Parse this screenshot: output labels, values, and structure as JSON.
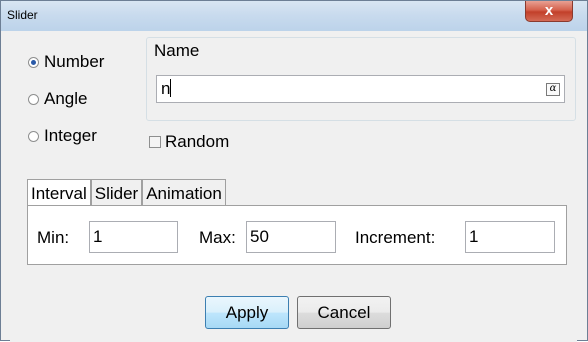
{
  "window": {
    "title": "Slider",
    "close_glyph": "x"
  },
  "type_options": [
    {
      "label": "Number",
      "checked": true
    },
    {
      "label": "Angle",
      "checked": false
    },
    {
      "label": "Integer",
      "checked": false
    }
  ],
  "name_section": {
    "label": "Name",
    "value": "n",
    "alpha_symbol": "α"
  },
  "random": {
    "label": "Random",
    "checked": false
  },
  "tabs": [
    {
      "label": "Interval",
      "active": true
    },
    {
      "label": "Slider",
      "active": false
    },
    {
      "label": "Animation",
      "active": false
    }
  ],
  "interval": {
    "min_label": "Min:",
    "min_value": "1",
    "max_label": "Max:",
    "max_value": "50",
    "increment_label": "Increment:",
    "increment_value": "1"
  },
  "buttons": {
    "apply": "Apply",
    "cancel": "Cancel"
  },
  "colors": {
    "default_button": "#a7d9f5",
    "close_button": "#c2402a",
    "radio_dot": "#2a5aa8"
  }
}
